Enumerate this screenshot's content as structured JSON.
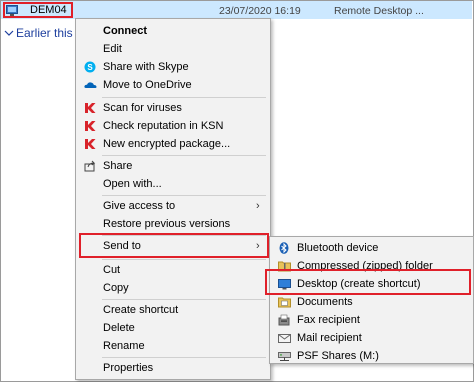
{
  "file": {
    "name": "DEM04",
    "date": "23/07/2020 16:19",
    "type": "Remote Desktop ..."
  },
  "group_header": "Earlier this w",
  "context_menu": {
    "items": [
      {
        "label": "Connect",
        "icon": "none",
        "bold": true
      },
      {
        "label": "Edit",
        "icon": "none"
      },
      {
        "label": "Share with Skype",
        "icon": "skype-icon"
      },
      {
        "label": "Move to OneDrive",
        "icon": "onedrive-icon"
      },
      {
        "label": "Scan for viruses",
        "icon": "kaspersky-icon"
      },
      {
        "label": "Check reputation in KSN",
        "icon": "kaspersky-icon"
      },
      {
        "label": "New encrypted package...",
        "icon": "kaspersky-icon"
      },
      {
        "label": "Share",
        "icon": "share-icon"
      },
      {
        "label": "Open with...",
        "icon": "none"
      },
      {
        "label": "Give access to",
        "icon": "none",
        "submenu": true
      },
      {
        "label": "Restore previous versions",
        "icon": "none"
      },
      {
        "label": "Send to",
        "icon": "none",
        "submenu": true
      },
      {
        "label": "Cut",
        "icon": "none"
      },
      {
        "label": "Copy",
        "icon": "none"
      },
      {
        "label": "Create shortcut",
        "icon": "none"
      },
      {
        "label": "Delete",
        "icon": "none"
      },
      {
        "label": "Rename",
        "icon": "none"
      },
      {
        "label": "Properties",
        "icon": "none"
      }
    ],
    "submenu_arrow": "›"
  },
  "send_to_menu": {
    "items": [
      {
        "label": "Bluetooth device",
        "icon": "bluetooth-icon"
      },
      {
        "label": "Compressed (zipped) folder",
        "icon": "zip-folder-icon"
      },
      {
        "label": "Desktop (create shortcut)",
        "icon": "desktop-icon"
      },
      {
        "label": "Documents",
        "icon": "documents-icon"
      },
      {
        "label": "Fax recipient",
        "icon": "fax-icon"
      },
      {
        "label": "Mail recipient",
        "icon": "mail-icon"
      },
      {
        "label": "PSF Shares (M:)",
        "icon": "network-drive-icon"
      }
    ]
  },
  "colors": {
    "selection": "#cce8ff",
    "highlight_box": "#e0202a",
    "kaspersky": "#d8232a",
    "skype": "#00aff0",
    "onedrive": "#0364b8"
  }
}
